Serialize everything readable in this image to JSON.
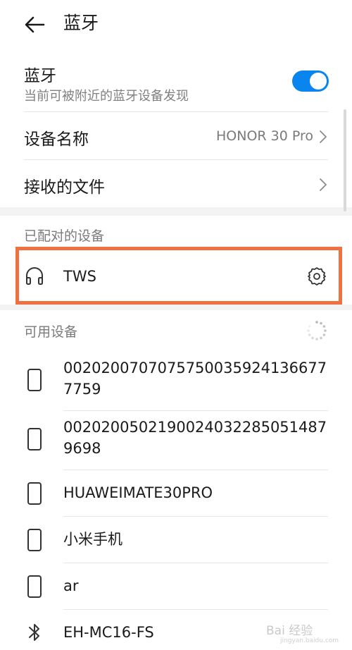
{
  "header": {
    "title": "蓝牙",
    "back_icon": "back-arrow-icon"
  },
  "bluetooth": {
    "label": "蓝牙",
    "subtitle": "当前可被附近的蓝牙设备发现",
    "enabled": true,
    "toggle_color": "#0a84ef"
  },
  "device_name": {
    "label": "设备名称",
    "value": "HONOR 30 Pro"
  },
  "received_files": {
    "label": "接收的文件"
  },
  "paired": {
    "section_label": "已配对的设备",
    "devices": [
      {
        "name": "TWS",
        "icon": "headphones-icon"
      }
    ],
    "highlight_color": "#ef7141"
  },
  "available": {
    "section_label": "可用设备",
    "devices": [
      {
        "name_line1": "0020200707075750035924136677",
        "name_line2": "7759",
        "icon": "phone-icon"
      },
      {
        "name_line1": "0020200502190024032285051487",
        "name_line2": "9698",
        "icon": "phone-icon"
      },
      {
        "name_line1": "HUAWEIMATE30PRO",
        "icon": "phone-icon"
      },
      {
        "name_line1": "小米手机",
        "icon": "phone-icon"
      },
      {
        "name_line1": "ar",
        "icon": "phone-icon"
      },
      {
        "name_line1": "EH-MC16-FS",
        "icon": "bluetooth-icon"
      }
    ]
  },
  "watermark": {
    "text": "Bai 经验",
    "sub": "jingyan.baidu.com"
  }
}
